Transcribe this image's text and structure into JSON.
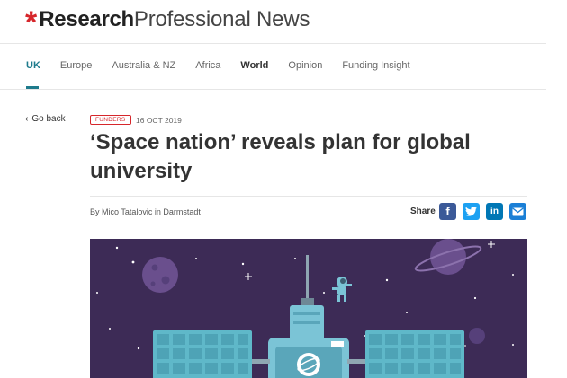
{
  "brand": {
    "logo_mark": "*",
    "name_bold": "Research",
    "name_light": "Professional News",
    "accent": "#d6262b"
  },
  "nav": {
    "items": [
      {
        "label": "UK",
        "state": "active"
      },
      {
        "label": "Europe",
        "state": "normal"
      },
      {
        "label": "Australia & NZ",
        "state": "normal"
      },
      {
        "label": "Africa",
        "state": "normal"
      },
      {
        "label": "World",
        "state": "bold"
      },
      {
        "label": "Opinion",
        "state": "normal"
      },
      {
        "label": "Funding Insight",
        "state": "normal"
      }
    ],
    "active_color": "#1e7b8c"
  },
  "article": {
    "back_label": "Go back",
    "category": "FUNDERS",
    "date": "16 OCT 2019",
    "title": "‘Space nation’ reveals plan for global university",
    "byline": "By Mico Tatalovic in Darmstadt",
    "share_label": "Share",
    "share_icons": [
      "facebook-icon",
      "twitter-icon",
      "linkedin-icon",
      "email-icon"
    ],
    "hero_background": "#3d2b56"
  }
}
